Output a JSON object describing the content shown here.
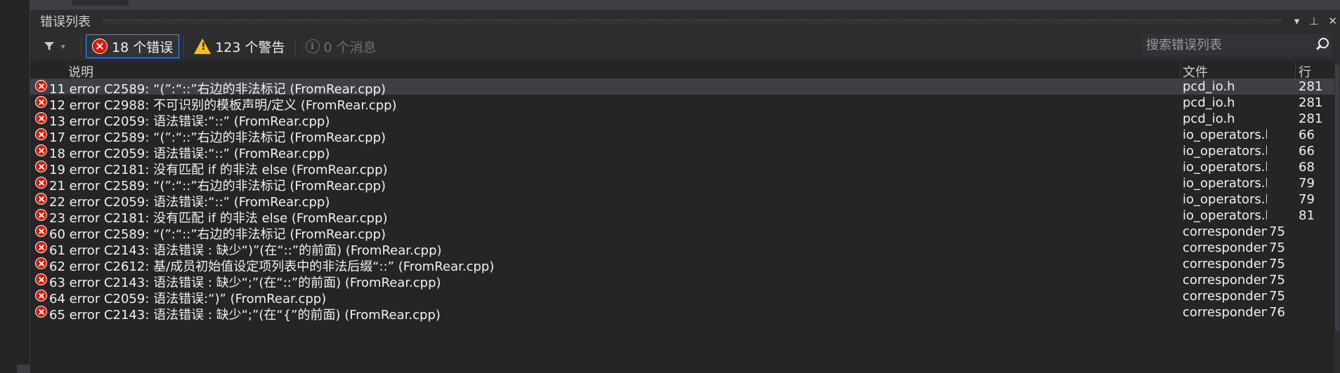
{
  "panel": {
    "title": "错误列表",
    "title_icons": [
      "dropdown-arrow-icon",
      "pin-icon",
      "close-icon"
    ]
  },
  "toolbar": {
    "filter_icon": "filter-icon",
    "errors_label": "18 个错误",
    "warnings_label": "123 个警告",
    "messages_label": "0 个消息",
    "search_placeholder": "搜索错误列表"
  },
  "columns": {
    "description": "说明",
    "file": "文件",
    "line": "行"
  },
  "colors": {
    "error": "#e51400",
    "warning": "#f4c40f",
    "accent": "#3399ff",
    "background": "#252526"
  },
  "rows": [
    {
      "id": "11",
      "code": "error C2589",
      "text": "“(”:“::”右边的非法标记 (FromRear.cpp)",
      "file": "pcd_io.h",
      "line": "281",
      "selected": true
    },
    {
      "id": "12",
      "code": "error C2988",
      "text": "不可识别的模板声明/定义 (FromRear.cpp)",
      "file": "pcd_io.h",
      "line": "281"
    },
    {
      "id": "13",
      "code": "error C2059",
      "text": "语法错误:“::” (FromRear.cpp)",
      "file": "pcd_io.h",
      "line": "281"
    },
    {
      "id": "17",
      "code": "error C2589",
      "text": "“(”:“::”右边的非法标记 (FromRear.cpp)",
      "file": "io_operators.h",
      "line": "66"
    },
    {
      "id": "18",
      "code": "error C2059",
      "text": "语法错误:“::” (FromRear.cpp)",
      "file": "io_operators.h",
      "line": "66"
    },
    {
      "id": "19",
      "code": "error C2181",
      "text": "没有匹配 if 的非法 else  (FromRear.cpp)",
      "file": "io_operators.h",
      "line": "68"
    },
    {
      "id": "21",
      "code": "error C2589",
      "text": "“(”:“::”右边的非法标记 (FromRear.cpp)",
      "file": "io_operators.h",
      "line": "79"
    },
    {
      "id": "22",
      "code": "error C2059",
      "text": "语法错误:“::” (FromRear.cpp)",
      "file": "io_operators.h",
      "line": "79"
    },
    {
      "id": "23",
      "code": "error C2181",
      "text": "没有匹配 if 的非法 else  (FromRear.cpp)",
      "file": "io_operators.h",
      "line": "81"
    },
    {
      "id": "60",
      "code": "error C2589",
      "text": "“(”:“::”右边的非法标记 (FromRear.cpp)",
      "file": "correspondence.l",
      "line": "75"
    },
    {
      "id": "61",
      "code": "error C2143",
      "text": "语法错误 : 缺少“)”(在“::”的前面) (FromRear.cpp)",
      "file": "correspondence.l",
      "line": "75"
    },
    {
      "id": "62",
      "code": "error C2612",
      "text": "基/成员初始值设定项列表中的非法后缀“::” (FromRear.cpp)",
      "file": "correspondence.l",
      "line": "75"
    },
    {
      "id": "63",
      "code": "error C2143",
      "text": "语法错误 : 缺少“;”(在“::”的前面) (FromRear.cpp)",
      "file": "correspondence.l",
      "line": "75"
    },
    {
      "id": "64",
      "code": "error C2059",
      "text": "语法错误:“)” (FromRear.cpp)",
      "file": "correspondence.l",
      "line": "75"
    },
    {
      "id": "65",
      "code": "error C2143",
      "text": "语法错误 : 缺少“;”(在“{”的前面) (FromRear.cpp)",
      "file": "correspondence.l",
      "line": "76"
    }
  ]
}
